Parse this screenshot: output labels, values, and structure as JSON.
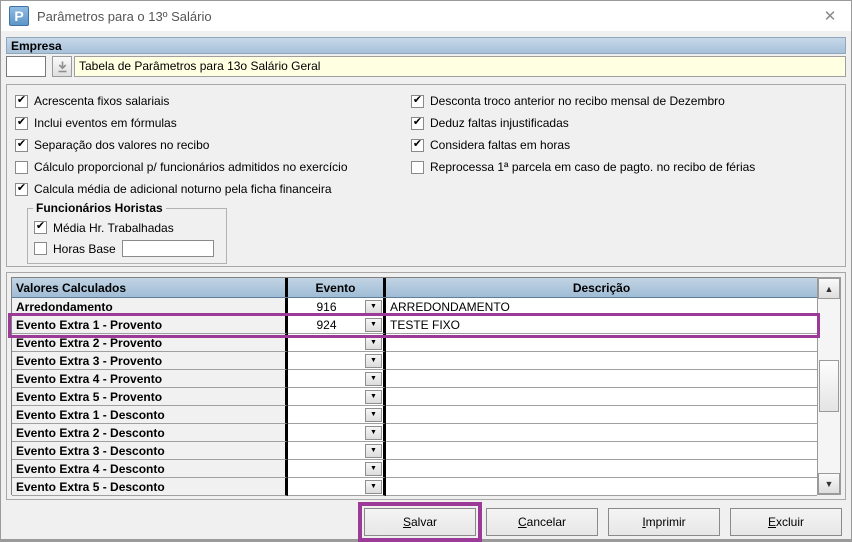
{
  "window": {
    "title": "Parâmetros para o 13º Salário",
    "icon_letter": "P"
  },
  "icons": {
    "close": "✕",
    "check": "✔",
    "dropdown": "▼",
    "scroll_up": "▲",
    "scroll_down": "▼",
    "lookup": "lookup-down-arrow"
  },
  "empresa": {
    "header": "Empresa",
    "code_value": "",
    "description": "Tabela de Parâmetros para 13o Salário Geral"
  },
  "options": {
    "left": [
      {
        "label": "Acrescenta fixos salariais",
        "checked": true
      },
      {
        "label": "Inclui eventos em fórmulas",
        "checked": true
      },
      {
        "label": "Separação dos valores no recibo",
        "checked": true
      },
      {
        "label": "Cálculo proporcional p/ funcionários admitidos no exercício",
        "checked": false
      },
      {
        "label": "Calcula média de adicional noturno pela ficha financeira",
        "checked": true
      }
    ],
    "right": [
      {
        "label": "Desconta troco anterior no recibo mensal de Dezembro",
        "checked": true
      },
      {
        "label": "Deduz faltas injustificadas",
        "checked": true
      },
      {
        "label": "Considera faltas em horas",
        "checked": true
      },
      {
        "label": "Reprocessa 1ª parcela em caso de pagto. no recibo de férias",
        "checked": false
      }
    ]
  },
  "horistas": {
    "title": "Funcionários Horistas",
    "media_hr": {
      "label": "Média Hr. Trabalhadas",
      "checked": true
    },
    "horas_base": {
      "label": "Horas Base",
      "checked": false,
      "value": ""
    }
  },
  "grid": {
    "headers": {
      "valores": "Valores Calculados",
      "evento": "Evento",
      "descricao": "Descrição"
    },
    "rows": [
      {
        "valores": "Arredondamento",
        "evento": "916",
        "descricao": "ARREDONDAMENTO",
        "highlighted": false
      },
      {
        "valores": "Evento Extra 1 - Provento",
        "evento": "924",
        "descricao": "TESTE FIXO",
        "highlighted": true
      },
      {
        "valores": "Evento Extra 2 - Provento",
        "evento": "",
        "descricao": "",
        "highlighted": false
      },
      {
        "valores": "Evento Extra 3 - Provento",
        "evento": "",
        "descricao": "",
        "highlighted": false
      },
      {
        "valores": "Evento Extra 4 - Provento",
        "evento": "",
        "descricao": "",
        "highlighted": false
      },
      {
        "valores": "Evento Extra 5 - Provento",
        "evento": "",
        "descricao": "",
        "highlighted": false
      },
      {
        "valores": "Evento Extra 1 - Desconto",
        "evento": "",
        "descricao": "",
        "highlighted": false
      },
      {
        "valores": "Evento Extra 2 - Desconto",
        "evento": "",
        "descricao": "",
        "highlighted": false
      },
      {
        "valores": "Evento Extra 3 - Desconto",
        "evento": "",
        "descricao": "",
        "highlighted": false
      },
      {
        "valores": "Evento Extra 4 - Desconto",
        "evento": "",
        "descricao": "",
        "highlighted": false
      },
      {
        "valores": "Evento Extra 5 - Desconto",
        "evento": "",
        "descricao": "",
        "highlighted": false
      }
    ]
  },
  "buttons": [
    {
      "label": "Salvar",
      "underline_index": 0,
      "highlighted": true
    },
    {
      "label": "Cancelar",
      "underline_index": 0,
      "highlighted": false
    },
    {
      "label": "Imprimir",
      "underline_index": 0,
      "highlighted": false
    },
    {
      "label": "Excluir",
      "underline_index": 0,
      "highlighted": false
    }
  ],
  "colors": {
    "annotation_purple": "#9B3B97",
    "header_blue": "#a7c1da",
    "header_blue_light": "#c7d8e8",
    "field_yellow": "#ffffe1",
    "dialog_bg": "#f0f0f0"
  }
}
